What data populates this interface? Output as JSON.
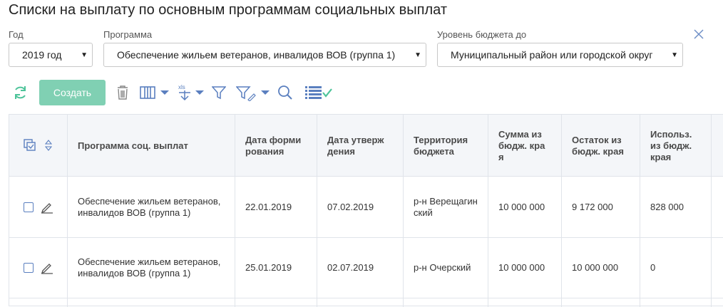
{
  "page": {
    "title": "Списки на выплату по основным программам социальных выплат"
  },
  "filters": {
    "year": {
      "label": "Год",
      "value": "2019 год"
    },
    "program": {
      "label": "Программа",
      "value": "Обеспечение жильем ветеранов, инвалидов ВОВ (группа 1)"
    },
    "budget_level": {
      "label": "Уровень бюджета до",
      "value": "Муниципальный район или городской округ"
    }
  },
  "toolbar": {
    "create_label": "Создать",
    "icons": [
      "refresh-icon",
      "trash-icon",
      "columns-icon",
      "export-xls-icon",
      "filter-icon",
      "filter-edit-icon",
      "search-icon",
      "list-check-icon"
    ]
  },
  "table": {
    "columns": [
      "Программа соц. выплат",
      "Дата форми рования",
      "Дата утверж дения",
      "Территория бюджета",
      "Сумма из бюдж. кра я",
      "Остаток из бюдж. края",
      "Использ. из бюдж. края"
    ],
    "rows": [
      {
        "program": "Обеспечение жильем ветеранов, инвалидов ВОВ (группа 1)",
        "created": "22.01.2019",
        "approved": "07.02.2019",
        "territory": "р-н Верещагин ский",
        "sum": "10 000 000",
        "rest": "9 172 000",
        "used": "828 000"
      },
      {
        "program": "Обеспечение жильем ветеранов, инвалидов ВОВ (группа 1)",
        "created": "25.01.2019",
        "approved": "02.07.2019",
        "territory": "р-н Очерский",
        "sum": "10 000 000",
        "rest": "10 000 000",
        "used": "0"
      }
    ]
  },
  "colors": {
    "accent": "#80d0b3",
    "icon": "#5a7fbf",
    "refresh": "#4ec49a"
  }
}
